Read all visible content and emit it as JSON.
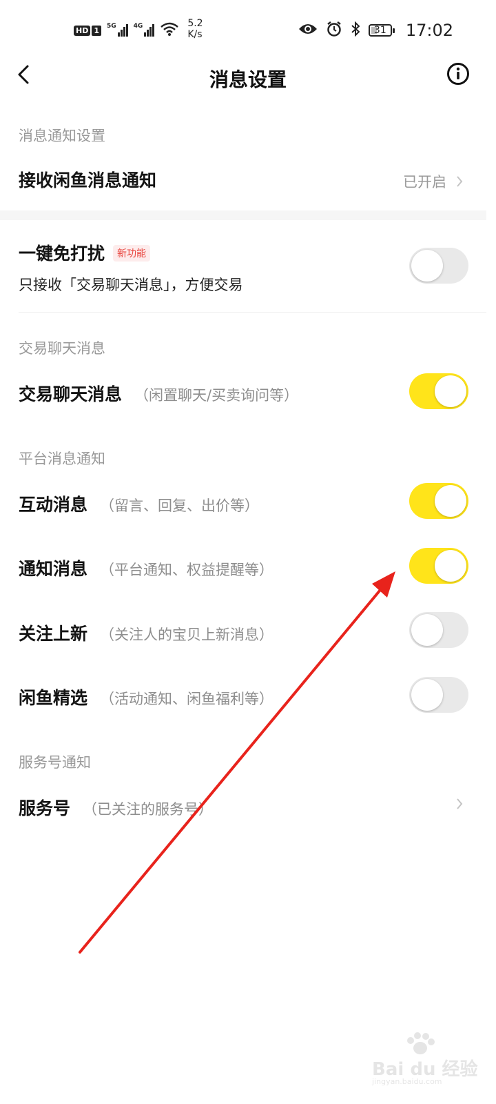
{
  "status_bar": {
    "hd": "HD",
    "sim": "1",
    "net1": "5G",
    "net2": "4G",
    "speed_value": "5.2",
    "speed_unit": "K/s",
    "battery": "31",
    "battery_level": 0.31,
    "time": "17:02"
  },
  "nav": {
    "title": "消息设置"
  },
  "sections": {
    "notice_label": "消息通知设置",
    "trade_label": "交易聊天消息",
    "platform_label": "平台消息通知",
    "service_label": "服务号通知"
  },
  "rows": {
    "receive": {
      "title": "接收闲鱼消息通知",
      "value": "已开启"
    },
    "dnd": {
      "title": "一键免打扰",
      "badge": "新功能",
      "desc": "只接收「交易聊天消息」，方便交易",
      "on": false
    },
    "trade_chat": {
      "title": "交易聊天消息",
      "sub": "（闲置聊天/买卖询问等）",
      "on": true
    },
    "interact": {
      "title": "互动消息",
      "sub": "（留言、回复、出价等）",
      "on": true
    },
    "notify": {
      "title": "通知消息",
      "sub": "（平台通知、权益提醒等）",
      "on": true
    },
    "follow": {
      "title": "关注上新",
      "sub": "（关注人的宝贝上新消息）",
      "on": false
    },
    "select": {
      "title": "闲鱼精选",
      "sub": "（活动通知、闲鱼福利等）",
      "on": false
    },
    "service": {
      "title": "服务号",
      "sub": "（已关注的服务号）"
    }
  },
  "colors": {
    "toggle_on": "#ffe41a",
    "toggle_off": "#e9e9e9",
    "annotation_arrow": "#e8231c"
  },
  "icons": {
    "back": "chevron-left-icon",
    "info": "info-icon",
    "chevron": "chevron-right-icon"
  },
  "watermark": {
    "text": "Bai du 经验",
    "url": "jingyan.baidu.com"
  }
}
